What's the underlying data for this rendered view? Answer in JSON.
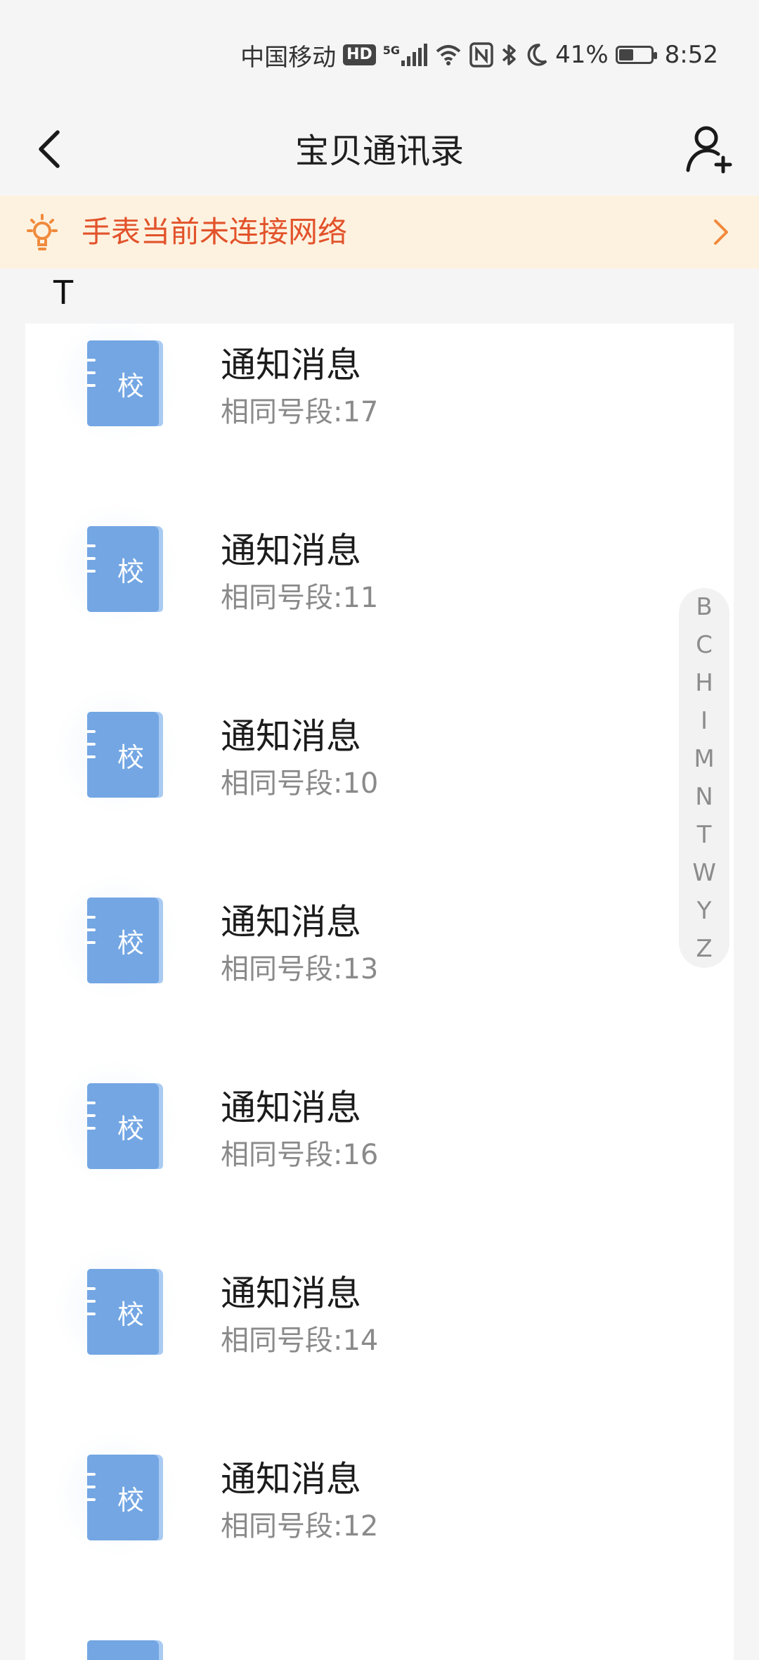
{
  "status_bar": {
    "carrier": "中国移动",
    "hd": "HD",
    "network": "5G",
    "battery": "41%",
    "time": "8:52",
    "icons": [
      "hd-icon",
      "signal-icon",
      "wifi-icon",
      "nfc-icon",
      "bluetooth-icon",
      "moon-icon",
      "battery-icon"
    ]
  },
  "header": {
    "title": "宝贝通讯录",
    "back_icon": "back-arrow-icon",
    "add_icon": "add-contact-icon"
  },
  "banner": {
    "text": "手表当前未连接网络",
    "icon": "lightbulb-icon",
    "arrow_icon": "chevron-right-icon",
    "text_color": "#e2532b",
    "background": "#fdf2e0"
  },
  "section": {
    "letter": "T"
  },
  "contacts": [
    {
      "name": "通知消息",
      "subtitle": "相同号段:17",
      "avatar_char": "校"
    },
    {
      "name": "通知消息",
      "subtitle": "相同号段:11",
      "avatar_char": "校"
    },
    {
      "name": "通知消息",
      "subtitle": "相同号段:10",
      "avatar_char": "校"
    },
    {
      "name": "通知消息",
      "subtitle": "相同号段:13",
      "avatar_char": "校"
    },
    {
      "name": "通知消息",
      "subtitle": "相同号段:16",
      "avatar_char": "校"
    },
    {
      "name": "通知消息",
      "subtitle": "相同号段:14",
      "avatar_char": "校"
    },
    {
      "name": "通知消息",
      "subtitle": "相同号段:12",
      "avatar_char": "校"
    }
  ],
  "index_bar": {
    "letters": [
      "B",
      "C",
      "H",
      "I",
      "M",
      "N",
      "T",
      "W",
      "Y",
      "Z"
    ]
  },
  "colors": {
    "avatar_book": "#73a6e3",
    "page_background": "#f5f5f6"
  }
}
